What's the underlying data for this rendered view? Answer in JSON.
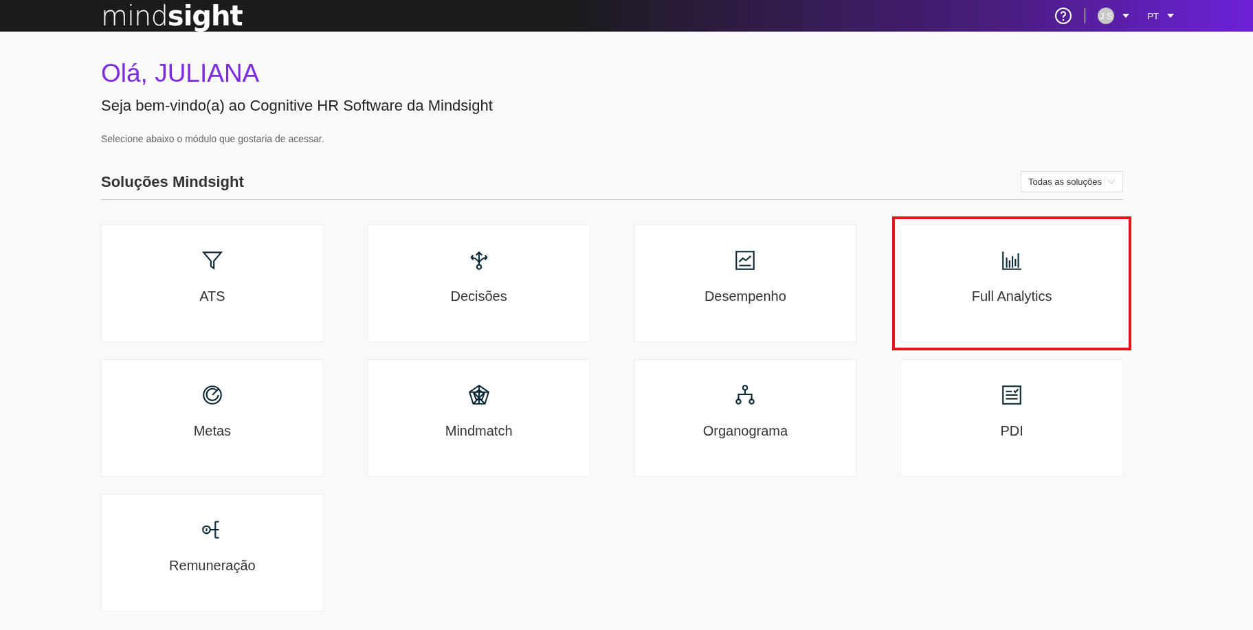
{
  "header": {
    "logo": "mind**sight**",
    "avatar": "J S",
    "language": "PT"
  },
  "greeting": "Olá, JULIANA",
  "subtitle": "Seja bem-vindo(a) ao Cognitive HR Software da Mindsight",
  "hint": "Selecione abaixo o módulo que gostaria de acessar.",
  "section": {
    "title": "Soluções Mindsight",
    "filter": "Todas as soluções"
  },
  "modules": [
    {
      "label": "ATS",
      "kind": "funnel",
      "highlighted": false
    },
    {
      "label": "Decisões",
      "kind": "split",
      "highlighted": false
    },
    {
      "label": "Desempenho",
      "kind": "linechart",
      "highlighted": false
    },
    {
      "label": "Full Analytics",
      "kind": "bars",
      "highlighted": true
    },
    {
      "label": "Metas",
      "kind": "target",
      "highlighted": false
    },
    {
      "label": "Mindmatch",
      "kind": "radar",
      "highlighted": false
    },
    {
      "label": "Organograma",
      "kind": "org",
      "highlighted": false
    },
    {
      "label": "PDI",
      "kind": "checklist",
      "highlighted": false
    },
    {
      "label": "Remuneração",
      "kind": "key",
      "highlighted": false
    }
  ]
}
